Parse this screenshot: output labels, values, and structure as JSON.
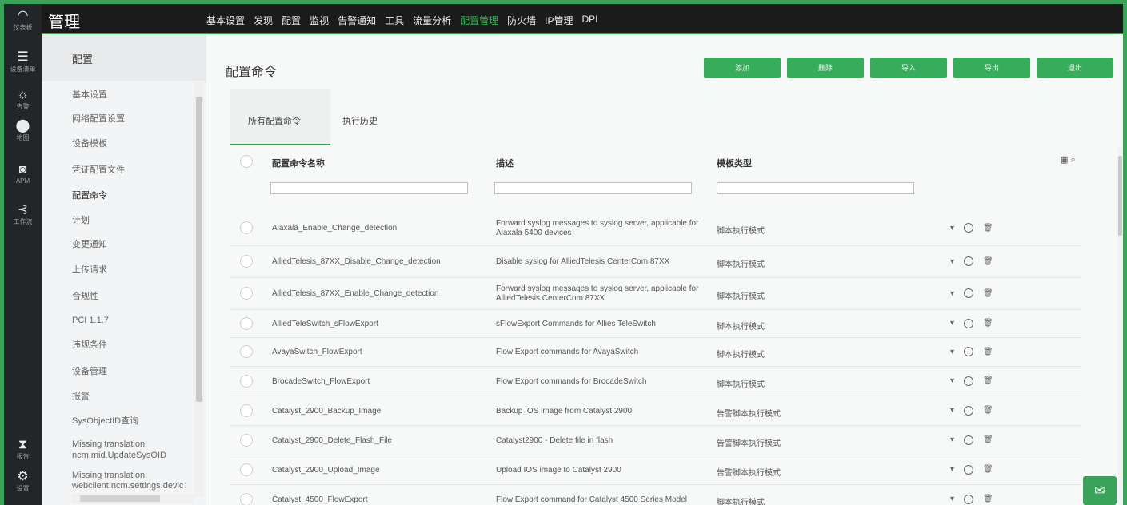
{
  "app": {
    "title": "管理"
  },
  "topnav": {
    "items": [
      "基本设置",
      "发现",
      "配置",
      "监视",
      "告警通知",
      "工具",
      "流量分析",
      "配置管理",
      "防火墙",
      "IP管理",
      "DPI"
    ],
    "active_index": 7
  },
  "rail": [
    {
      "icon": "dashboard-icon",
      "glyph": "◠",
      "label": "仪表板"
    },
    {
      "icon": "list-icon",
      "glyph": "☰",
      "label": "设备清单"
    },
    {
      "icon": "alert-bug-icon",
      "glyph": "☼",
      "label": "告警"
    },
    {
      "icon": "map-pin-icon",
      "glyph": "⬤",
      "label": "地图"
    },
    {
      "icon": "apm-icon",
      "glyph": "◙",
      "label": "APM"
    },
    {
      "icon": "workflow-icon",
      "glyph": "⊰",
      "label": "工作流"
    },
    {
      "icon": "reports-icon",
      "glyph": "⧗",
      "label": "报告"
    },
    {
      "icon": "settings-icon",
      "glyph": "⚙",
      "label": "设置"
    }
  ],
  "sidebar": {
    "title": "配置",
    "items": [
      "基本设置",
      "网络配置设置",
      "设备模板",
      "凭证配置文件",
      "配置命令",
      "计划",
      "变更通知",
      "上传请求",
      "合规性",
      "PCI 1.1.7",
      "违规条件",
      "设备管理",
      "报警",
      "SysObjectID查询",
      "Missing translation:",
      "ncm.mid.UpdateSysOID",
      "Missing translation:",
      "webclient.ncm.settings.devic"
    ],
    "active_index": 4
  },
  "page": {
    "title": "配置命令",
    "buttons": [
      "添加",
      "删除",
      "导入",
      "导出",
      "退出"
    ],
    "tabs": [
      "所有配置命令",
      "执行历史"
    ]
  },
  "table": {
    "headers": [
      "配置命令名称",
      "描述",
      "模板类型"
    ],
    "rows": [
      {
        "name": "Alaxala_Enable_Change_detection",
        "desc": "Forward syslog messages to syslog server, applicable for Alaxala 5400 devices",
        "type": "脚本执行模式"
      },
      {
        "name": "AlliedTelesis_87XX_Disable_Change_detection",
        "desc": "Disable syslog for AlliedTelesis CenterCom 87XX",
        "type": "脚本执行模式"
      },
      {
        "name": "AlliedTelesis_87XX_Enable_Change_detection",
        "desc": "Forward syslog messages to syslog server, applicable for AlliedTelesis CenterCom 87XX",
        "type": "脚本执行模式"
      },
      {
        "name": "AlliedTeleSwitch_sFlowExport",
        "desc": "sFlowExport Commands for Allies TeleSwitch",
        "type": "脚本执行模式"
      },
      {
        "name": "AvayaSwitch_FlowExport",
        "desc": "Flow Export commands for AvayaSwitch",
        "type": "脚本执行模式"
      },
      {
        "name": "BrocadeSwitch_FlowExport",
        "desc": "Flow Export commands for BrocadeSwitch",
        "type": "脚本执行模式"
      },
      {
        "name": "Catalyst_2900_Backup_Image",
        "desc": "Backup IOS image from Catalyst 2900",
        "type": "告警脚本执行模式"
      },
      {
        "name": "Catalyst_2900_Delete_Flash_File",
        "desc": "Catalyst2900 - Delete file in flash",
        "type": "告警脚本执行模式"
      },
      {
        "name": "Catalyst_2900_Upload_Image",
        "desc": "Upload IOS image to Catalyst 2900",
        "type": "告警脚本执行模式"
      },
      {
        "name": "Catalyst_4500_FlowExport",
        "desc": "Flow Export command for Catalyst 4500 Series Model",
        "type": "脚本执行模式"
      }
    ]
  }
}
